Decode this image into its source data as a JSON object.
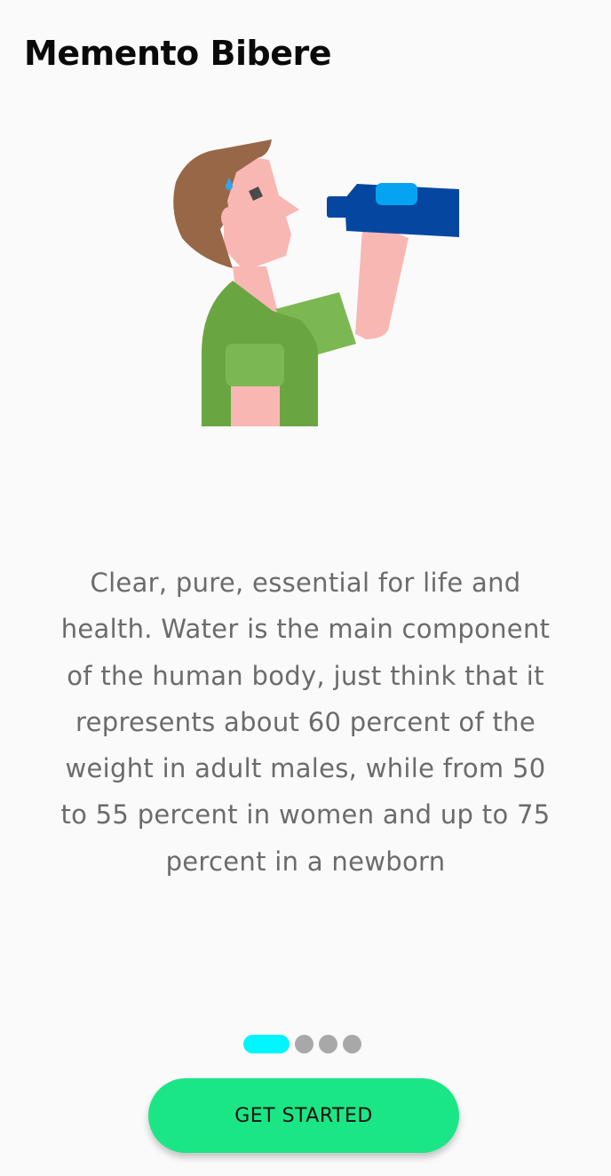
{
  "header": {
    "title": "Memento Bibere"
  },
  "illustration": {
    "icon": "person-drinking-water-icon",
    "colors": {
      "hair": "#986748",
      "skin": "#f9b7b4",
      "shirt": "#69a641",
      "shirt_light": "#7cb852",
      "bottle": "#0547a0",
      "bottle_label": "#06a3f2",
      "sweat_drop": "#2fa6e8"
    }
  },
  "content": {
    "description": "Clear, pure, essential for life and health. Water is the main component of the human body, just think that it represents about 60 percent of the weight in adult males, while from 50 to 55 percent in women and up to 75 percent in a newborn"
  },
  "pager": {
    "total_pages": 4,
    "current_page": 1,
    "active_color": "#00f5ff",
    "inactive_color": "#a8a8a8"
  },
  "actions": {
    "get_started_label": "GET STARTED",
    "button_color": "#1be685"
  }
}
